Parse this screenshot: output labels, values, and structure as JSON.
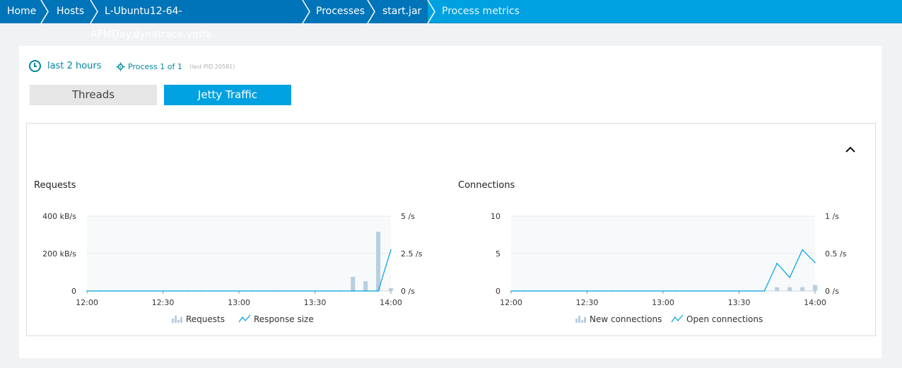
{
  "breadcrumb": {
    "items": [
      {
        "label": "Home"
      },
      {
        "label": "Hosts"
      },
      {
        "label": "L-Ubuntu12-64-APMDay.dynatrace.vmta"
      },
      {
        "label": "Processes"
      },
      {
        "label": "start.jar"
      },
      {
        "label": "Process metrics"
      }
    ]
  },
  "toolbar": {
    "timeframe_label": "last 2 hours",
    "process_label": "Process 1 of 1",
    "pid_label": "(last PID 20581)"
  },
  "tabs": [
    {
      "label": "Threads",
      "active": false
    },
    {
      "label": "Jetty Traffic",
      "active": true
    }
  ],
  "colors": {
    "accent": "#00a1e0",
    "breadcrumb_dark": "#0074b8",
    "teal_text": "#00889c",
    "bar": "#b7cfe0",
    "line": "#00a1e0"
  },
  "icons": {
    "timeframe": "clock-icon",
    "process": "process-icon",
    "collapse": "chevron-up-icon",
    "legend_bar": "bar-chart-icon",
    "legend_line": "line-chart-icon"
  },
  "chart_data": [
    {
      "type": "bar",
      "title": "Requests",
      "x": [
        "12:00",
        "12:05",
        "12:10",
        "12:15",
        "12:20",
        "12:25",
        "12:30",
        "12:35",
        "12:40",
        "12:45",
        "12:50",
        "12:55",
        "13:00",
        "13:05",
        "13:10",
        "13:15",
        "13:20",
        "13:25",
        "13:30",
        "13:35",
        "13:40",
        "13:45",
        "13:50",
        "13:55",
        "14:00"
      ],
      "xticks": [
        "12:00",
        "12:30",
        "13:00",
        "13:30",
        "14:00"
      ],
      "left_axis": {
        "ticks": [
          "0",
          "200 kB/s",
          "400 kB/s"
        ],
        "range": [
          0,
          400
        ]
      },
      "right_axis": {
        "ticks": [
          "0 /s",
          "2.5 /s",
          "5 /s"
        ],
        "range": [
          0,
          5
        ]
      },
      "series": [
        {
          "name": "Requests",
          "kind": "bar",
          "axis": "right",
          "values": [
            0,
            0,
            0,
            0,
            0,
            0,
            0,
            0,
            0,
            0,
            0,
            0,
            0,
            0,
            0,
            0,
            0,
            0,
            0,
            0,
            0,
            0.95,
            0.65,
            3.95,
            0.2
          ]
        },
        {
          "name": "Response size",
          "kind": "line",
          "axis": "left",
          "values": [
            0,
            0,
            0,
            0,
            0,
            0,
            0,
            0,
            0,
            0,
            0,
            0,
            0,
            0,
            0,
            0,
            0,
            0,
            0,
            0,
            0,
            0,
            0,
            0,
            220
          ]
        }
      ],
      "legend": [
        "Requests",
        "Response size"
      ]
    },
    {
      "type": "bar",
      "title": "Connections",
      "x": [
        "12:00",
        "12:05",
        "12:10",
        "12:15",
        "12:20",
        "12:25",
        "12:30",
        "12:35",
        "12:40",
        "12:45",
        "12:50",
        "12:55",
        "13:00",
        "13:05",
        "13:10",
        "13:15",
        "13:20",
        "13:25",
        "13:30",
        "13:35",
        "13:40",
        "13:45",
        "13:50",
        "13:55",
        "14:00"
      ],
      "xticks": [
        "12:00",
        "12:30",
        "13:00",
        "13:30",
        "14:00"
      ],
      "left_axis": {
        "ticks": [
          "0",
          "5",
          "10"
        ],
        "range": [
          0,
          10
        ]
      },
      "right_axis": {
        "ticks": [
          "0 /s",
          "0.5 /s",
          "1 /s"
        ],
        "range": [
          0,
          1
        ]
      },
      "series": [
        {
          "name": "New connections",
          "kind": "bar",
          "axis": "left",
          "values": [
            0,
            0,
            0,
            0,
            0,
            0,
            0,
            0,
            0,
            0,
            0,
            0,
            0,
            0,
            0,
            0,
            0,
            0,
            0,
            0,
            0,
            0.5,
            0.5,
            0.5,
            0.8
          ]
        },
        {
          "name": "Open connections",
          "kind": "line",
          "axis": "right",
          "values": [
            0,
            0,
            0,
            0,
            0,
            0,
            0,
            0,
            0,
            0,
            0,
            0,
            0,
            0,
            0,
            0,
            0,
            0,
            0,
            0,
            0,
            0.37,
            0.18,
            0.55,
            0.38
          ]
        }
      ],
      "legend": [
        "New connections",
        "Open connections"
      ]
    }
  ]
}
